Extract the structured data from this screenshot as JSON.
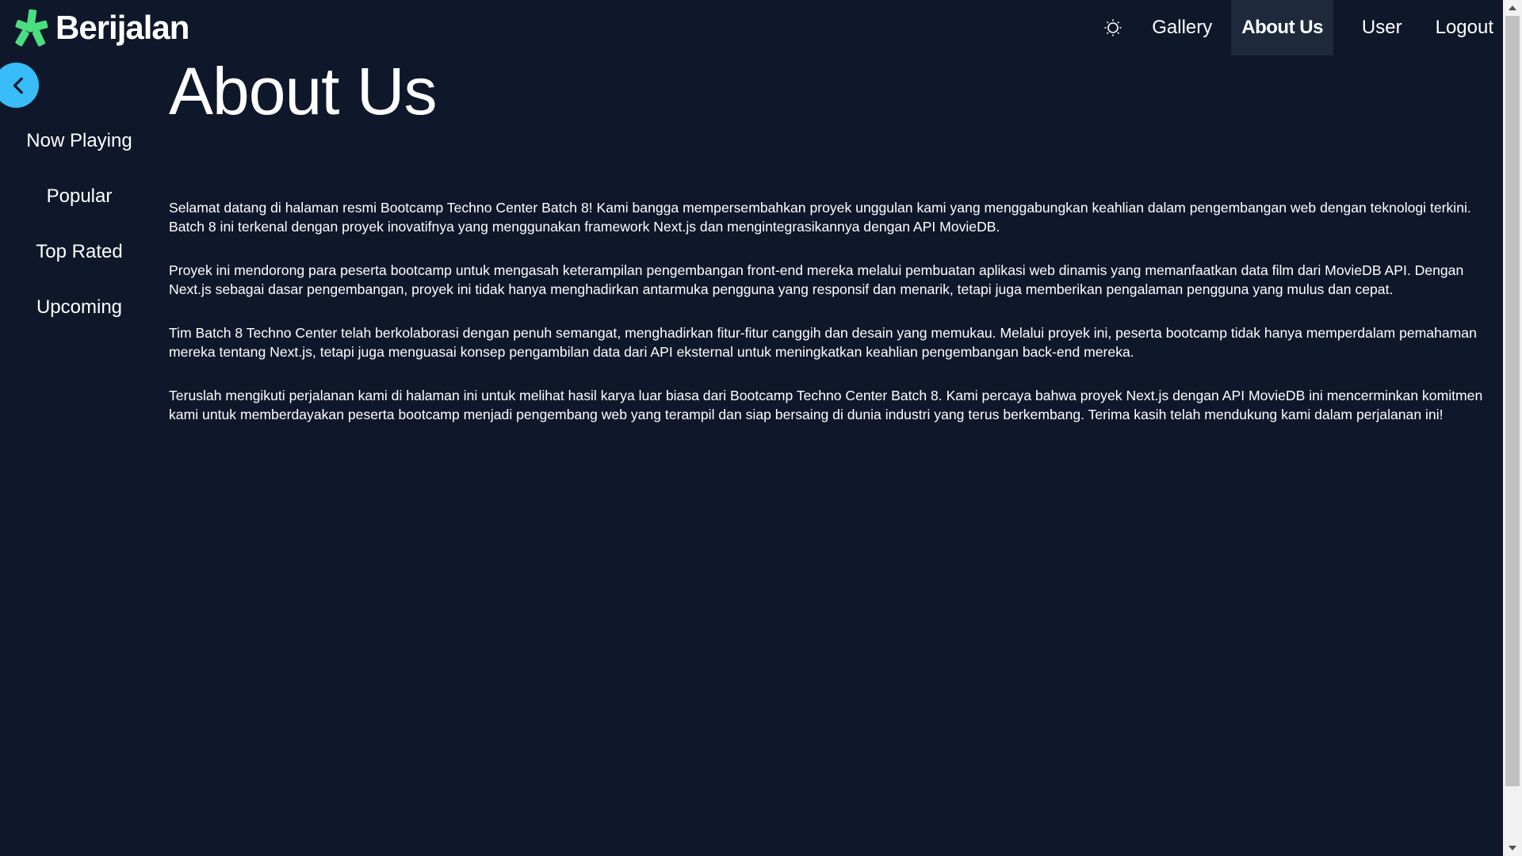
{
  "brand": {
    "name": "Berijalan",
    "logo_icon": "berijalan-logo-icon",
    "logo_color": "#4ade80"
  },
  "nav": {
    "theme_icon": "sun-icon",
    "items": [
      {
        "label": "Gallery",
        "active": false
      },
      {
        "label": "About Us",
        "active": true
      },
      {
        "label": "User",
        "active": false
      },
      {
        "label": "Logout",
        "active": false
      }
    ]
  },
  "sidebar": {
    "collapse_icon": "chevron-left-icon",
    "collapse_color": "#38bdf8",
    "items": [
      {
        "label": "Now Playing"
      },
      {
        "label": "Popular"
      },
      {
        "label": "Top Rated"
      },
      {
        "label": "Upcoming"
      }
    ]
  },
  "main": {
    "title": "About Us",
    "paragraphs": [
      "Selamat datang di halaman resmi Bootcamp Techno Center Batch 8! Kami bangga mempersembahkan proyek unggulan kami yang menggabungkan keahlian dalam pengembangan web dengan teknologi terkini. Batch 8 ini terkenal dengan proyek inovatifnya yang menggunakan framework Next.js dan mengintegrasikannya dengan API MovieDB.",
      "Proyek ini mendorong para peserta bootcamp untuk mengasah keterampilan pengembangan front-end mereka melalui pembuatan aplikasi web dinamis yang memanfaatkan data film dari MovieDB API. Dengan Next.js sebagai dasar pengembangan, proyek ini tidak hanya menghadirkan antarmuka pengguna yang responsif dan menarik, tetapi juga memberikan pengalaman pengguna yang mulus dan cepat.",
      "Tim Batch 8 Techno Center telah berkolaborasi dengan penuh semangat, menghadirkan fitur-fitur canggih dan desain yang memukau. Melalui proyek ini, peserta bootcamp tidak hanya memperdalam pemahaman mereka tentang Next.js, tetapi juga menguasai konsep pengambilan data dari API eksternal untuk meningkatkan keahlian pengembangan back-end mereka.",
      "Teruslah mengikuti perjalanan kami di halaman ini untuk melihat hasil karya luar biasa dari Bootcamp Techno Center Batch 8. Kami percaya bahwa proyek Next.js dengan API MovieDB ini mencerminkan komitmen kami untuk memberdayakan peserta bootcamp menjadi pengembang web yang terampil dan siap bersaing di dunia industri yang terus berkembang. Terima kasih telah mendukung kami dalam perjalanan ini!"
    ]
  },
  "colors": {
    "background": "#0f172a",
    "active_nav_bg": "#1e293b",
    "text": "#ffffff"
  }
}
